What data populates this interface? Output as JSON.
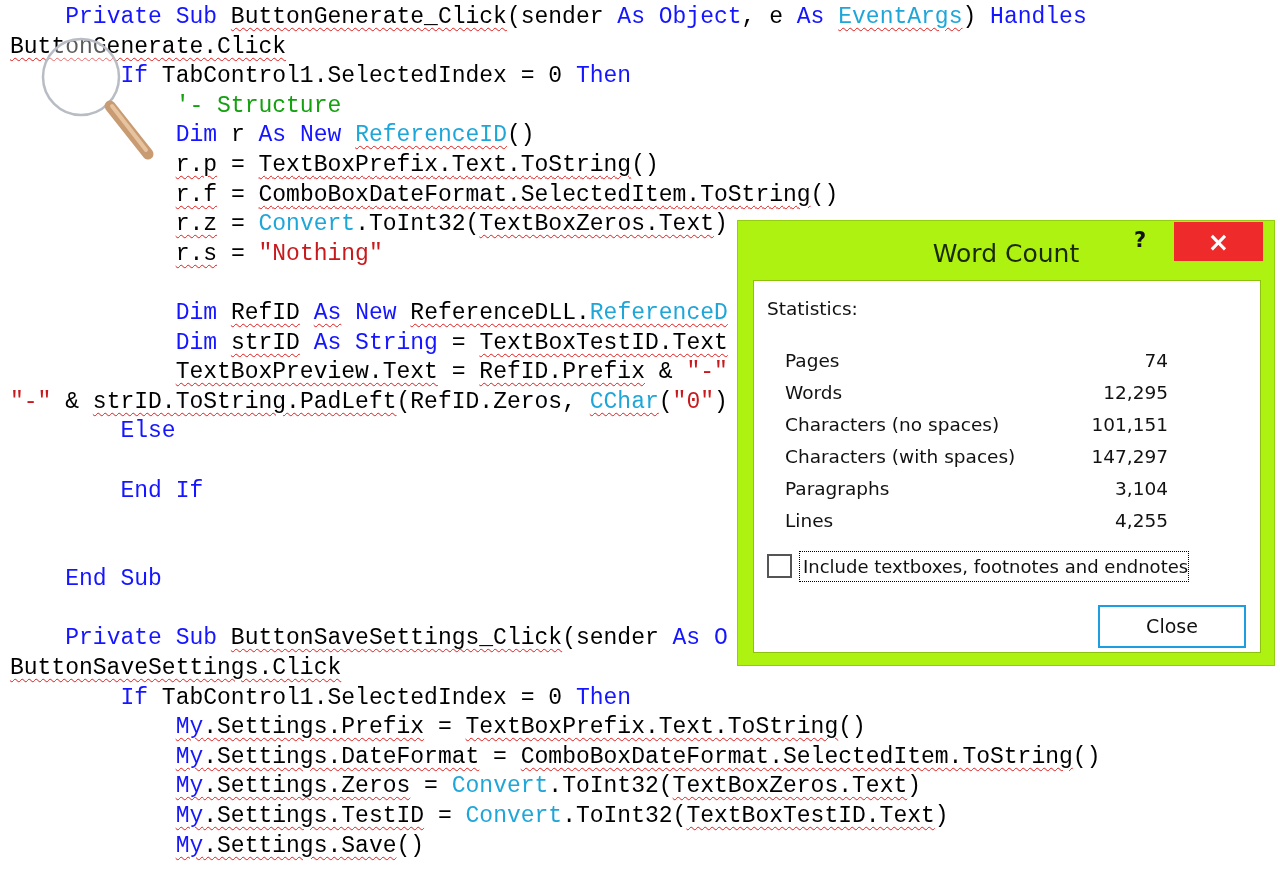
{
  "document": {
    "lines": [
      {
        "kind": "code",
        "tokens": [
          {
            "text": "    Private Sub ",
            "kind": "keyword",
            "flagged": false
          },
          {
            "text": "ButtonGenerate_Click",
            "kind": "plain",
            "flagged": true
          },
          {
            "text": "(sender ",
            "kind": "plain",
            "flagged": false
          },
          {
            "text": "As Object",
            "kind": "keyword",
            "flagged": false
          },
          {
            "text": ", e ",
            "kind": "plain",
            "flagged": false
          },
          {
            "text": "As ",
            "kind": "keyword",
            "flagged": false
          },
          {
            "text": "EventArgs",
            "kind": "type",
            "flagged": true
          },
          {
            "text": ") ",
            "kind": "plain",
            "flagged": false
          },
          {
            "text": "Handles",
            "kind": "keyword",
            "flagged": false
          }
        ]
      },
      {
        "kind": "code",
        "tokens": [
          {
            "text": "ButtonGenerate.Click",
            "kind": "plain",
            "flagged": true
          }
        ]
      },
      {
        "kind": "code",
        "tokens": [
          {
            "text": "        If ",
            "kind": "keyword",
            "flagged": false
          },
          {
            "text": "TabControl1.SelectedIndex = 0 ",
            "kind": "plain",
            "flagged": false
          },
          {
            "text": "Then",
            "kind": "keyword",
            "flagged": false
          }
        ]
      },
      {
        "kind": "code",
        "tokens": [
          {
            "text": "            '- Structure",
            "kind": "comment",
            "flagged": false
          }
        ]
      },
      {
        "kind": "code",
        "tokens": [
          {
            "text": "            Dim ",
            "kind": "keyword",
            "flagged": false
          },
          {
            "text": "r ",
            "kind": "plain",
            "flagged": false
          },
          {
            "text": "As New ",
            "kind": "keyword",
            "flagged": false
          },
          {
            "text": "ReferenceID",
            "kind": "type",
            "flagged": true
          },
          {
            "text": "()",
            "kind": "plain",
            "flagged": false
          }
        ]
      },
      {
        "kind": "code",
        "tokens": [
          {
            "text": "            r.p",
            "kind": "plain",
            "flagged": true
          },
          {
            "text": " = ",
            "kind": "plain",
            "flagged": false
          },
          {
            "text": "TextBoxPrefix.Text.ToString",
            "kind": "plain",
            "flagged": true
          },
          {
            "text": "()",
            "kind": "plain",
            "flagged": false
          }
        ]
      },
      {
        "kind": "code",
        "tokens": [
          {
            "text": "            r.f",
            "kind": "plain",
            "flagged": true
          },
          {
            "text": " = ",
            "kind": "plain",
            "flagged": false
          },
          {
            "text": "ComboBoxDateFormat.SelectedItem.ToString",
            "kind": "plain",
            "flagged": true
          },
          {
            "text": "()",
            "kind": "plain",
            "flagged": false
          }
        ]
      },
      {
        "kind": "code",
        "tokens": [
          {
            "text": "            r.z",
            "kind": "plain",
            "flagged": true
          },
          {
            "text": " = ",
            "kind": "plain",
            "flagged": false
          },
          {
            "text": "Convert",
            "kind": "type",
            "flagged": false
          },
          {
            "text": ".ToInt32(",
            "kind": "plain",
            "flagged": false
          },
          {
            "text": "TextBoxZeros.Text",
            "kind": "plain",
            "flagged": true
          },
          {
            "text": ")",
            "kind": "plain",
            "flagged": false
          }
        ]
      },
      {
        "kind": "code",
        "tokens": [
          {
            "text": "            r.s",
            "kind": "plain",
            "flagged": true
          },
          {
            "text": " = ",
            "kind": "plain",
            "flagged": false
          },
          {
            "text": "\"Nothing\"",
            "kind": "string",
            "flagged": false
          }
        ]
      },
      {
        "kind": "blank"
      },
      {
        "kind": "code",
        "tokens": [
          {
            "text": "            Dim ",
            "kind": "keyword",
            "flagged": false
          },
          {
            "text": "RefID ",
            "kind": "plain",
            "flagged": true
          },
          {
            "text": "As",
            "kind": "keyword",
            "flagged": true
          },
          {
            "text": " New ",
            "kind": "keyword",
            "flagged": false
          },
          {
            "text": "ReferenceDLL.",
            "kind": "plain",
            "flagged": true
          },
          {
            "text": "ReferenceD",
            "kind": "type",
            "flagged": true
          }
        ]
      },
      {
        "kind": "code",
        "tokens": [
          {
            "text": "            Dim ",
            "kind": "keyword",
            "flagged": false
          },
          {
            "text": "strID ",
            "kind": "plain",
            "flagged": true
          },
          {
            "text": "As String",
            "kind": "keyword",
            "flagged": false
          },
          {
            "text": " = ",
            "kind": "plain",
            "flagged": false
          },
          {
            "text": "TextBoxTestID.Text",
            "kind": "plain",
            "flagged": true
          }
        ]
      },
      {
        "kind": "code",
        "tokens": [
          {
            "text": "            TextBoxPreview.Text",
            "kind": "plain",
            "flagged": true
          },
          {
            "text": " = ",
            "kind": "plain",
            "flagged": false
          },
          {
            "text": "RefID.Prefix",
            "kind": "plain",
            "flagged": true
          },
          {
            "text": " & ",
            "kind": "plain",
            "flagged": false
          },
          {
            "text": "\"-\"",
            "kind": "string",
            "flagged": false
          }
        ]
      },
      {
        "kind": "code",
        "tokens": [
          {
            "text": "\"-\"",
            "kind": "string",
            "flagged": false
          },
          {
            "text": " & ",
            "kind": "plain",
            "flagged": false
          },
          {
            "text": "strID.ToString.PadLeft",
            "kind": "plain",
            "flagged": true
          },
          {
            "text": "(RefID.Zeros, ",
            "kind": "plain",
            "flagged": false
          },
          {
            "text": "CChar",
            "kind": "type",
            "flagged": true
          },
          {
            "text": "(",
            "kind": "plain",
            "flagged": false
          },
          {
            "text": "\"0\"",
            "kind": "string",
            "flagged": false
          },
          {
            "text": ")",
            "kind": "plain",
            "flagged": false
          }
        ]
      },
      {
        "kind": "code",
        "tokens": [
          {
            "text": "        Else",
            "kind": "keyword",
            "flagged": false
          }
        ]
      },
      {
        "kind": "blank"
      },
      {
        "kind": "code",
        "tokens": [
          {
            "text": "        End If",
            "kind": "keyword",
            "flagged": false
          }
        ]
      },
      {
        "kind": "blank"
      },
      {
        "kind": "blank"
      },
      {
        "kind": "code",
        "tokens": [
          {
            "text": "    End Sub",
            "kind": "keyword",
            "flagged": false
          }
        ]
      },
      {
        "kind": "blank"
      },
      {
        "kind": "code",
        "tokens": [
          {
            "text": "    Private Sub ",
            "kind": "keyword",
            "flagged": false
          },
          {
            "text": "ButtonSaveSettings_Click",
            "kind": "plain",
            "flagged": true
          },
          {
            "text": "(sender ",
            "kind": "plain",
            "flagged": false
          },
          {
            "text": "As O",
            "kind": "keyword",
            "flagged": false
          }
        ]
      },
      {
        "kind": "code",
        "tokens": [
          {
            "text": "ButtonSaveSettings.Click",
            "kind": "plain",
            "flagged": true
          }
        ]
      },
      {
        "kind": "code",
        "tokens": [
          {
            "text": "        If ",
            "kind": "keyword",
            "flagged": false
          },
          {
            "text": "TabControl1.SelectedIndex = 0 ",
            "kind": "plain",
            "flagged": false
          },
          {
            "text": "Then",
            "kind": "keyword",
            "flagged": false
          }
        ]
      },
      {
        "kind": "code",
        "tokens": [
          {
            "text": "            My",
            "kind": "keyword",
            "flagged": true
          },
          {
            "text": ".Settings.Prefix",
            "kind": "plain",
            "flagged": true
          },
          {
            "text": " = ",
            "kind": "plain",
            "flagged": false
          },
          {
            "text": "TextBoxPrefix.Text.ToString",
            "kind": "plain",
            "flagged": true
          },
          {
            "text": "()",
            "kind": "plain",
            "flagged": false
          }
        ]
      },
      {
        "kind": "code",
        "tokens": [
          {
            "text": "            My",
            "kind": "keyword",
            "flagged": true
          },
          {
            "text": ".Settings.DateFormat",
            "kind": "plain",
            "flagged": true
          },
          {
            "text": " = ",
            "kind": "plain",
            "flagged": false
          },
          {
            "text": "ComboBoxDateFormat.SelectedItem.ToString",
            "kind": "plain",
            "flagged": true
          },
          {
            "text": "()",
            "kind": "plain",
            "flagged": false
          }
        ]
      },
      {
        "kind": "code",
        "tokens": [
          {
            "text": "            My",
            "kind": "keyword",
            "flagged": true
          },
          {
            "text": ".Settings.Zeros",
            "kind": "plain",
            "flagged": true
          },
          {
            "text": " = ",
            "kind": "plain",
            "flagged": false
          },
          {
            "text": "Convert",
            "kind": "type",
            "flagged": false
          },
          {
            "text": ".ToInt32(",
            "kind": "plain",
            "flagged": false
          },
          {
            "text": "TextBoxZeros.Text",
            "kind": "plain",
            "flagged": true
          },
          {
            "text": ")",
            "kind": "plain",
            "flagged": false
          }
        ]
      },
      {
        "kind": "code",
        "tokens": [
          {
            "text": "            My",
            "kind": "keyword",
            "flagged": true
          },
          {
            "text": ".Settings.TestID",
            "kind": "plain",
            "flagged": true
          },
          {
            "text": " = ",
            "kind": "plain",
            "flagged": false
          },
          {
            "text": "Convert",
            "kind": "type",
            "flagged": false
          },
          {
            "text": ".ToInt32(",
            "kind": "plain",
            "flagged": false
          },
          {
            "text": "TextBoxTestID.Text",
            "kind": "plain",
            "flagged": true
          },
          {
            "text": ")",
            "kind": "plain",
            "flagged": false
          }
        ]
      },
      {
        "kind": "code",
        "tokens": [
          {
            "text": "            My",
            "kind": "keyword",
            "flagged": true
          },
          {
            "text": ".Settings.Save",
            "kind": "plain",
            "flagged": true
          },
          {
            "text": "()",
            "kind": "plain",
            "flagged": false
          }
        ]
      }
    ]
  },
  "dialog": {
    "title": "Word Count",
    "help": "?",
    "close": "×",
    "section_label": "Statistics:",
    "stats": [
      {
        "label": "Pages",
        "value": "74"
      },
      {
        "label": "Words",
        "value": "12,295"
      },
      {
        "label": "Characters (no spaces)",
        "value": "101,151"
      },
      {
        "label": "Characters (with spaces)",
        "value": "147,297"
      },
      {
        "label": "Paragraphs",
        "value": "3,104"
      },
      {
        "label": "Lines",
        "value": "4,255"
      }
    ],
    "checkbox": {
      "label": "Include textboxes, footnotes and endnotes",
      "checked": false,
      "focused": true
    },
    "buttons": [
      "Close"
    ]
  }
}
